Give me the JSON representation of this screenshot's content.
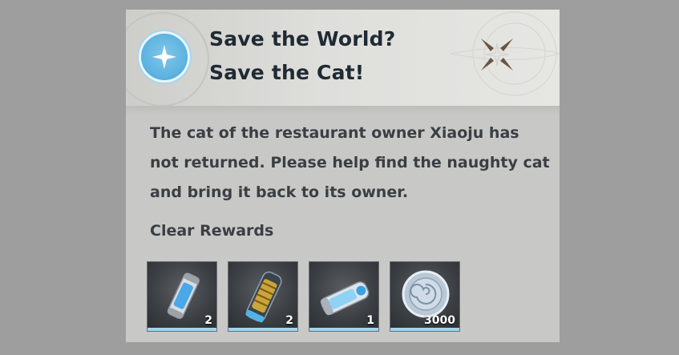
{
  "quest": {
    "icon": "quest-compass-icon",
    "title_line1": "Save the World?",
    "title_line2": "Save the Cat!",
    "brand_icon": "four-point-star-emblem-icon",
    "description": "The cat of the restaurant owner Xiaoju has not returned. Please help find the naughty cat and bring it back to its owner.",
    "rewards_label": "Clear Rewards",
    "rewards": [
      {
        "icon": "blue-canister-icon",
        "quantity": "2"
      },
      {
        "icon": "gold-coil-capsule-icon",
        "quantity": "2"
      },
      {
        "icon": "energy-cylinder-icon",
        "quantity": "1"
      },
      {
        "icon": "silver-coin-icon",
        "quantity": "3000"
      }
    ]
  },
  "colors": {
    "background": "#9e9e9e",
    "panel": "#c8c9c6",
    "title_text": "#1f2a33",
    "body_text": "#3a3f44",
    "accent_blue": "#5fb4e0",
    "emblem_brown": "#6b5440",
    "rarity_bar": "#9fd3ec"
  }
}
